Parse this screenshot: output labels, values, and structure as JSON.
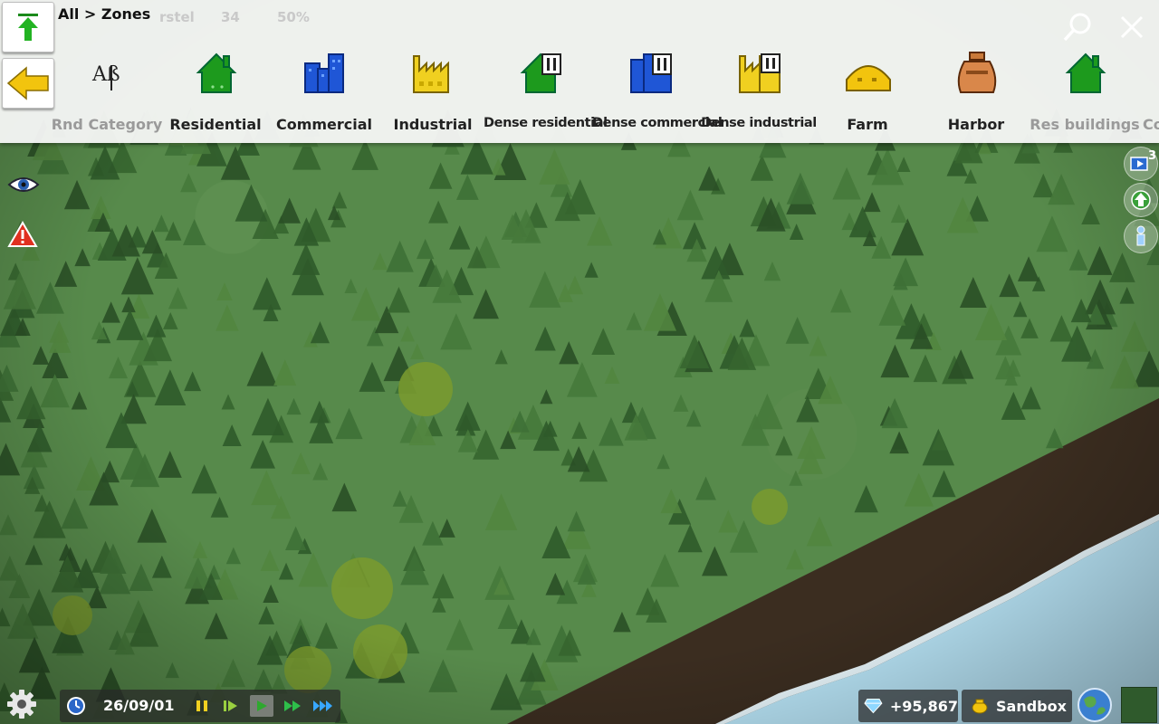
{
  "breadcrumb": "All > Zones",
  "faded_info": {
    "city_fragment": "rstel",
    "population": "34",
    "happiness": "50%"
  },
  "toolbar": {
    "items": [
      {
        "label": "Rnd Category",
        "icon": "random-category-icon",
        "dim": true
      },
      {
        "label": "Residential",
        "icon": "residential-house-icon"
      },
      {
        "label": "Commercial",
        "icon": "commercial-buildings-icon"
      },
      {
        "label": "Industrial",
        "icon": "factory-icon"
      },
      {
        "label": "Dense residential",
        "icon": "dense-residential-icon"
      },
      {
        "label": "Dense commercial",
        "icon": "dense-commercial-icon"
      },
      {
        "label": "Dense industrial",
        "icon": "dense-factory-icon"
      },
      {
        "label": "Farm",
        "icon": "farm-dome-icon"
      },
      {
        "label": "Harbor",
        "icon": "harbor-sack-icon"
      },
      {
        "label": "Res buildings",
        "icon": "residential-house-icon",
        "dim": true
      },
      {
        "label": "Co",
        "icon": "",
        "dim": true
      }
    ],
    "up_icon": "arrow-up-icon",
    "back_icon": "arrow-left-icon",
    "search_icon": "search-icon",
    "close_icon": "close-icon"
  },
  "side": {
    "view_icon": "eye-icon",
    "warning_icon": "warning-icon"
  },
  "overlays": {
    "top_badge": "3"
  },
  "bottom": {
    "date": "26/09/01",
    "money": "+95,867",
    "mode": "Sandbox"
  },
  "colors": {
    "residential": "#1d9a1d",
    "commercial": "#1f56d6",
    "industrial": "#f0d020",
    "water": "#b8e4f6",
    "dirt": "#3c2f22",
    "forest": "#578a4b"
  }
}
